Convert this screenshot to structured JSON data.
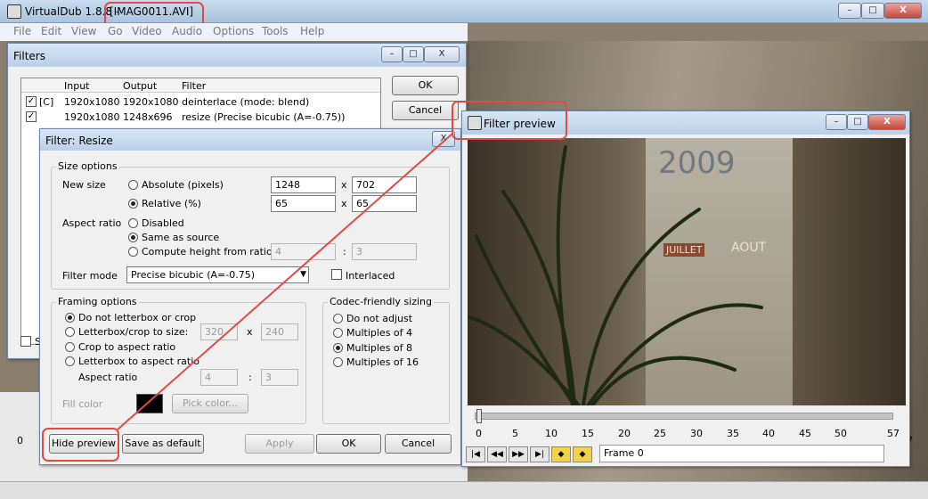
{
  "main": {
    "title_prefix": "VirtualDub 1.8.8 - ",
    "title_file": "[IMAG0011.AVI]",
    "menus": [
      "File",
      "Edit",
      "View",
      "Go",
      "Video",
      "Audio",
      "Options",
      "Tools",
      "Help"
    ],
    "bottom_tick_left": "0",
    "bottom_s": "S",
    "bottom_right_num": "7"
  },
  "filters": {
    "title": "Filters",
    "columns": [
      "Input",
      "Output",
      "Filter"
    ],
    "rows": [
      {
        "flag": "[C]",
        "input": "1920x1080",
        "output": "1920x1080",
        "filter": "deinterlace (mode: blend)"
      },
      {
        "flag": "",
        "input": "1920x1080",
        "output": "1248x696",
        "filter": "resize (Precise bicubic (A=-0.75))"
      }
    ],
    "ok": "OK",
    "cancel": "Cancel"
  },
  "resize": {
    "title": "Filter: Resize",
    "size_options": "Size options",
    "new_size": "New size",
    "absolute": "Absolute (pixels)",
    "abs_w": "1248",
    "abs_h": "702",
    "relative": "Relative (%)",
    "rel_w": "65",
    "rel_h": "65",
    "x": "x",
    "aspect_ratio": "Aspect ratio",
    "disabled": "Disabled",
    "same_as_source": "Same as source",
    "compute_height": "Compute height from ratio:",
    "ratio_a": "4",
    "ratio_b": "3",
    "colon": ":",
    "filter_mode": "Filter mode",
    "filter_mode_value": "Precise bicubic (A=-0.75)",
    "interlaced": "Interlaced",
    "framing": "Framing options",
    "no_letterbox": "Do not letterbox or crop",
    "letterbox_size": "Letterbox/crop to size:",
    "lb_w": "320",
    "lb_h": "240",
    "crop_aspect": "Crop to aspect ratio",
    "letterbox_aspect": "Letterbox to aspect ratio",
    "fr_aspect_label": "Aspect ratio",
    "fr_a": "4",
    "fr_b": "3",
    "fill_color": "Fill color",
    "pick_color": "Pick color...",
    "fill_color_hex": "#000000",
    "codec": "Codec-friendly sizing",
    "do_not_adjust": "Do not adjust",
    "mult4": "Multiples of 4",
    "mult8": "Multiples of 8",
    "mult16": "Multiples of 16",
    "hide_preview": "Hide preview",
    "save_default": "Save as default",
    "apply": "Apply",
    "ok": "OK",
    "cancel": "Cancel"
  },
  "preview": {
    "title": "Filter preview",
    "ticks": [
      "0",
      "5",
      "10",
      "15",
      "20",
      "25",
      "30",
      "35",
      "40",
      "45",
      "50",
      "57"
    ],
    "frame": "Frame 0",
    "calendar_year": "2009",
    "calendar_left": "JUILLET",
    "calendar_right": "AOUT"
  },
  "colors": {
    "highlight": "#e04b46",
    "title_gradient": "#b9cfe8"
  }
}
